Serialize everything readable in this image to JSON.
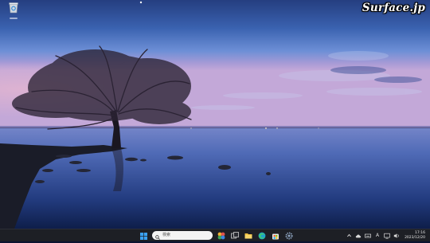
{
  "desktop": {
    "wallpaper": "lakeside-tree-at-dusk",
    "icons": [
      {
        "name": "recycle-bin",
        "icon": "recycle-bin-icon"
      }
    ]
  },
  "watermark": {
    "text": "Surface.jp"
  },
  "taskbar": {
    "background": "#1d1f25",
    "start_icon": "windows-logo-icon",
    "search": {
      "icon": "search-icon",
      "placeholder": "検索"
    },
    "pinned": [
      {
        "name": "widgets",
        "icon": "colorful-app-icon"
      },
      {
        "name": "task-view",
        "icon": "task-view-icon"
      },
      {
        "name": "file-explorer",
        "icon": "folder-icon"
      },
      {
        "name": "edge",
        "icon": "edge-icon"
      },
      {
        "name": "store",
        "icon": "store-icon"
      },
      {
        "name": "settings",
        "icon": "gear-icon"
      }
    ],
    "tray": {
      "chevron_icon": "chevron-up-icon",
      "icons": [
        "cloud-icon",
        "keyboard-icon",
        "ime-icon",
        "display-icon",
        "volume-icon"
      ],
      "ime_text": "A",
      "time": "17:16",
      "date": "2023/12/20"
    }
  }
}
